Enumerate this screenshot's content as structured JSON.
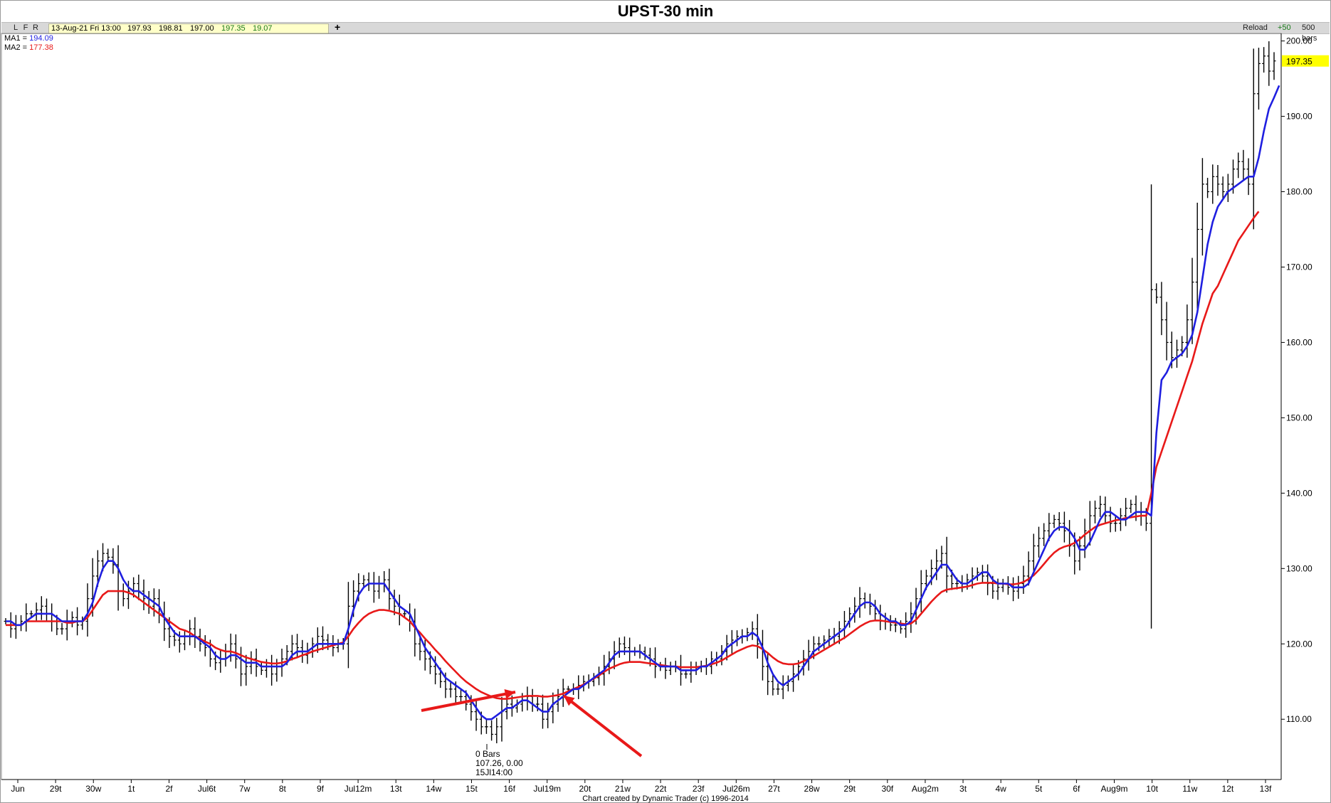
{
  "title": "UPST-30 min",
  "toolbar": {
    "buttons": [
      "L",
      "F",
      "R"
    ],
    "quote": {
      "date": "13-Aug-21 Fri 13:00",
      "open": "197.93",
      "high": "198.81",
      "low": "197.00",
      "close": "197.35",
      "change": "19.07"
    },
    "add_symbol": "+",
    "reload": "Reload",
    "plus50": "+50",
    "bars": "500 bars"
  },
  "ma_legend": {
    "ma1_label": "MA1 =",
    "ma1_value": "194.09",
    "ma2_label": "MA2 =",
    "ma2_value": "177.38"
  },
  "colors": {
    "price": "#000000",
    "ma1": "#1f1fe0",
    "ma2": "#e81919",
    "arrow": "#e81919",
    "last_price_bg": "#ffff00"
  },
  "annotation": {
    "lines": [
      "0 Bars",
      "107.26, 0.00",
      "15Jl14:00"
    ]
  },
  "footer": "Chart created by Dynamic Trader  (c) 1996-2014",
  "chart_data": {
    "type": "bar",
    "title": "UPST-30 min",
    "xlabel": "",
    "ylabel": "",
    "ylim": [
      102,
      201
    ],
    "y_ticks": [
      200,
      190,
      180,
      170,
      160,
      150,
      140,
      130,
      120,
      110
    ],
    "y_tick_labels": [
      "200.00",
      "190.00",
      "180.00",
      "170.00",
      "160.00",
      "150.00",
      "140.00",
      "130.00",
      "120.00",
      "110.00"
    ],
    "last_price": 197.35,
    "x_tick_labels": [
      "Jun",
      "29t",
      "30w",
      "1t",
      "2f",
      "Jul6t",
      "7w",
      "8t",
      "9f",
      "Jul12m",
      "13t",
      "14w",
      "15t",
      "16f",
      "Jul19m",
      "20t",
      "21w",
      "22t",
      "23f",
      "Jul26m",
      "27t",
      "28w",
      "29t",
      "30f",
      "Aug2m",
      "3t",
      "4w",
      "5t",
      "6f",
      "Aug9m",
      "10t",
      "11w",
      "12t",
      "13f"
    ],
    "series": [
      {
        "name": "Price",
        "type": "ohlc",
        "close": [
          123,
          122,
          122.5,
          123,
          124,
          124,
          124.5,
          125,
          124,
          123,
          122,
          122,
          123,
          123.5,
          122.5,
          123,
          126,
          129,
          131,
          132,
          131.5,
          130.5,
          127,
          126,
          127,
          128,
          127,
          126,
          125,
          126,
          124,
          122,
          121,
          120.5,
          120,
          121,
          122,
          121,
          120,
          119.5,
          118,
          117.5,
          118,
          119,
          120,
          118,
          116,
          117,
          118,
          117,
          116.5,
          117,
          116,
          117,
          118,
          119,
          120,
          119.5,
          118.5,
          119,
          120,
          121,
          120.5,
          120,
          119.5,
          120,
          120,
          125,
          127,
          128,
          128.5,
          128,
          127,
          128,
          128.5,
          126,
          125,
          124,
          124,
          123,
          120,
          119,
          118,
          117,
          116,
          115,
          114,
          114,
          113,
          113,
          112,
          111,
          110,
          109,
          109,
          108,
          109,
          111,
          112,
          111.5,
          112,
          112.5,
          113,
          112,
          112,
          110,
          111,
          112,
          113,
          114,
          114,
          114,
          114.5,
          115,
          115,
          115.5,
          116,
          117,
          118,
          119,
          120,
          119.5,
          119,
          119,
          119,
          118.5,
          118,
          117,
          117,
          116.5,
          117,
          117,
          116,
          116,
          116.5,
          117,
          117,
          117,
          118,
          118,
          119,
          120,
          120.5,
          121,
          121,
          121.5,
          122,
          120,
          117,
          115,
          114,
          114,
          114.5,
          115,
          116,
          117,
          118,
          119,
          120,
          120,
          120.5,
          121,
          121,
          122,
          123,
          124,
          125,
          126,
          125.5,
          125,
          124,
          123,
          123,
          122.5,
          122.5,
          122,
          123,
          124,
          126,
          128,
          129,
          130,
          131,
          132,
          129,
          128,
          128,
          128,
          128.5,
          129,
          129.5,
          129,
          128,
          127,
          127.5,
          128,
          127.5,
          127,
          128,
          129,
          131,
          133,
          134,
          135,
          136,
          136.5,
          136,
          135,
          133,
          131,
          133,
          135,
          137,
          138,
          138.5,
          137,
          136,
          136,
          137,
          138,
          138.5,
          137.5,
          137,
          136,
          167,
          166,
          163,
          160,
          158,
          159,
          160,
          163,
          168,
          175,
          181,
          180,
          182,
          181,
          180,
          181,
          183,
          184,
          183,
          181,
          193,
          197,
          198,
          196,
          197.35
        ],
        "high_low_note": "OHLC bars rendered as vertical high-low ranges with right-hand close ticks"
      },
      {
        "name": "MA1",
        "values": [
          123,
          123,
          122.5,
          122.5,
          123,
          123.5,
          124,
          124,
          124,
          124,
          123.5,
          123,
          123,
          123,
          123,
          123,
          124,
          125.5,
          128,
          130,
          131,
          131,
          130,
          128.5,
          127.5,
          127,
          127,
          126.5,
          126,
          125.5,
          125,
          123.5,
          122.5,
          121.5,
          121,
          121,
          121,
          121,
          120.5,
          120,
          119.5,
          118.5,
          118,
          118,
          118.5,
          118.5,
          118,
          117.5,
          117.5,
          117.5,
          117,
          117,
          117,
          117,
          117,
          117.5,
          118.5,
          119,
          119,
          119,
          119.5,
          120,
          120,
          120,
          120,
          120,
          120,
          122,
          124.5,
          126.5,
          127.5,
          128,
          128,
          128,
          128,
          127,
          126,
          125,
          124.5,
          124,
          122.5,
          121,
          119.5,
          118.5,
          117.5,
          116.5,
          115.5,
          115,
          114.5,
          114,
          113.5,
          112.5,
          111.5,
          110.5,
          110,
          110,
          110.5,
          111,
          111.5,
          111.5,
          112,
          112.5,
          112.5,
          112,
          111.5,
          111,
          111,
          112,
          112.5,
          113,
          113.5,
          114,
          114,
          114.5,
          115,
          115.5,
          116,
          116.5,
          117.5,
          118.5,
          119,
          119,
          119,
          119,
          119,
          118.5,
          118,
          117.5,
          117,
          117,
          117,
          117,
          116.5,
          116.5,
          116.5,
          116.5,
          117,
          117,
          117.5,
          118,
          118.5,
          119.5,
          120,
          120.5,
          121,
          121,
          121.5,
          121,
          119.5,
          117.5,
          116,
          115,
          114.5,
          115,
          115.5,
          116,
          117,
          118,
          119,
          119.5,
          120,
          120.5,
          121,
          121.5,
          122,
          123,
          124,
          125,
          125.5,
          125.5,
          125,
          124,
          123.5,
          123,
          123,
          122.5,
          122.5,
          123,
          124.5,
          126,
          127.5,
          128.5,
          129.5,
          130.5,
          130.5,
          129.5,
          128.5,
          128,
          128,
          128.5,
          129,
          129.5,
          129.5,
          128.5,
          128,
          128,
          128,
          127.5,
          127.5,
          127.5,
          128,
          129.5,
          131,
          132.5,
          134,
          135,
          135.5,
          135.5,
          135,
          134,
          132.5,
          132.5,
          133.5,
          135,
          136.5,
          137.5,
          137.5,
          137,
          136.5,
          136.5,
          137,
          137.5,
          137.5,
          137.5,
          137,
          148,
          155,
          156,
          157.5,
          158,
          158.5,
          159.5,
          161,
          164,
          168.5,
          173,
          176,
          178,
          179,
          180,
          180.5,
          181,
          181.5,
          182,
          182,
          184.5,
          188,
          191,
          192.5,
          194.09
        ]
      },
      {
        "name": "MA2",
        "values": [
          122.5,
          122.5,
          122.5,
          122.5,
          123,
          123,
          123,
          123,
          123,
          123,
          123,
          123,
          122.8,
          122.8,
          123,
          123,
          123.5,
          124.5,
          125.5,
          126.5,
          127,
          127,
          127,
          127,
          126.8,
          126.5,
          126,
          125.5,
          125,
          124.5,
          124,
          123.5,
          123,
          122.5,
          122,
          121.8,
          121.5,
          121,
          120.7,
          120.3,
          120,
          119.5,
          119.2,
          119,
          119,
          118.8,
          118.5,
          118.2,
          118,
          117.8,
          117.6,
          117.5,
          117.4,
          117.4,
          117.5,
          117.7,
          118,
          118.2,
          118.5,
          118.7,
          119,
          119.2,
          119.4,
          119.6,
          119.8,
          120,
          120.2,
          121,
          122,
          122.8,
          123.5,
          124,
          124.3,
          124.5,
          124.5,
          124.4,
          124.2,
          124,
          123.5,
          123,
          122.2,
          121.5,
          120.7,
          120,
          119.2,
          118.5,
          117.7,
          117,
          116.3,
          115.6,
          115,
          114.5,
          114,
          113.6,
          113.3,
          113,
          112.8,
          112.7,
          112.7,
          112.8,
          112.9,
          113,
          113.1,
          113.1,
          113.1,
          113,
          113,
          113.1,
          113.2,
          113.4,
          113.7,
          114,
          114.3,
          114.6,
          115,
          115.4,
          115.8,
          116.3,
          116.7,
          117,
          117.3,
          117.5,
          117.6,
          117.6,
          117.6,
          117.5,
          117.4,
          117.3,
          117.2,
          117.1,
          117,
          117,
          116.9,
          116.9,
          116.9,
          116.9,
          117,
          117.1,
          117.3,
          117.5,
          117.8,
          118.2,
          118.6,
          119,
          119.3,
          119.6,
          119.8,
          119.7,
          119.3,
          118.8,
          118.2,
          117.7,
          117.4,
          117.3,
          117.3,
          117.4,
          117.7,
          118,
          118.4,
          118.8,
          119.2,
          119.6,
          120,
          120.4,
          120.8,
          121.3,
          121.8,
          122.3,
          122.7,
          123,
          123.1,
          123.1,
          123,
          122.9,
          122.8,
          122.7,
          122.6,
          122.7,
          123.2,
          124,
          124.8,
          125.6,
          126.3,
          126.9,
          127.2,
          127.3,
          127.4,
          127.5,
          127.6,
          127.8,
          128,
          128.1,
          128.1,
          128.1,
          128,
          128,
          127.9,
          127.9,
          128,
          128.2,
          128.6,
          129.1,
          129.8,
          130.6,
          131.4,
          132.1,
          132.6,
          132.9,
          133.1,
          133.4,
          133.9,
          134.5,
          135,
          135.5,
          135.8,
          136,
          136.2,
          136.4,
          136.5,
          136.7,
          136.8,
          136.9,
          137,
          137,
          140,
          143.5,
          145.5,
          147.5,
          149.5,
          151.5,
          153.5,
          155.5,
          157.5,
          160,
          162.5,
          164.5,
          166.5,
          167.5,
          169,
          170.5,
          172,
          173.5,
          174.5,
          175.5,
          176.5,
          177.38
        ]
      }
    ]
  }
}
